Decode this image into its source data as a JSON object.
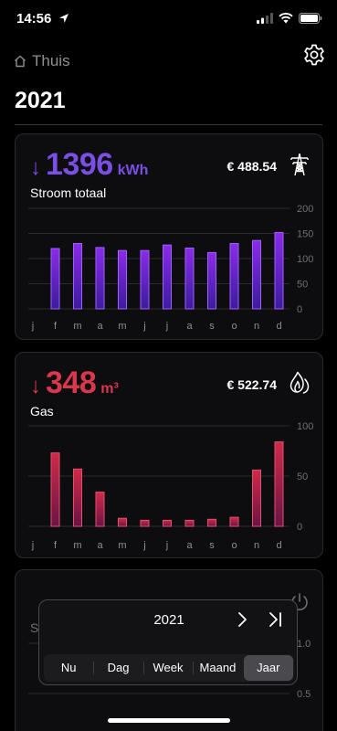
{
  "status": {
    "time": "14:56"
  },
  "header": {
    "back_label": "Thuis",
    "title": "2021"
  },
  "colors": {
    "electricity": "#7b4ee6",
    "gas": "#d9374e",
    "bg": "#000000",
    "card": "#0d0d0f"
  },
  "electricity": {
    "arrow": "↓",
    "total": "1396",
    "unit": "kWh",
    "label": "Stroom totaal",
    "cost": "€ 488.54",
    "icon": "power-pylon-icon"
  },
  "gas": {
    "arrow": "↓",
    "total": "348",
    "unit": "m³",
    "label": "Gas",
    "cost": "€ 522.74",
    "icon": "flame-icon"
  },
  "third": {
    "label": "St",
    "icon": "power-icon"
  },
  "chart_data": [
    {
      "type": "bar",
      "title": "",
      "categories": [
        "j",
        "f",
        "m",
        "a",
        "m",
        "j",
        "j",
        "a",
        "s",
        "o",
        "n",
        "d"
      ],
      "values": [
        0,
        120,
        130,
        122,
        116,
        116,
        127,
        121,
        112,
        130,
        136,
        152
      ],
      "yticks": [
        "200",
        "150",
        "100",
        "50",
        "0"
      ],
      "ylim": [
        0,
        200
      ],
      "grid": true
    },
    {
      "type": "bar",
      "title": "",
      "categories": [
        "j",
        "f",
        "m",
        "a",
        "m",
        "j",
        "j",
        "a",
        "s",
        "o",
        "n",
        "d"
      ],
      "values": [
        0,
        73,
        57,
        34,
        8,
        6,
        6,
        6,
        7,
        9,
        56,
        84
      ],
      "yticks": [
        "100",
        "50",
        "0"
      ],
      "ylim": [
        0,
        100
      ],
      "grid": true
    },
    {
      "type": "bar",
      "title": "",
      "categories": [],
      "values": [],
      "yticks": [
        "1.0",
        "0.5"
      ],
      "ylim": [
        0,
        1
      ],
      "grid": true
    }
  ],
  "picker": {
    "year": "2021",
    "options": [
      "Nu",
      "Dag",
      "Week",
      "Maand",
      "Jaar"
    ],
    "selected": "Jaar"
  }
}
